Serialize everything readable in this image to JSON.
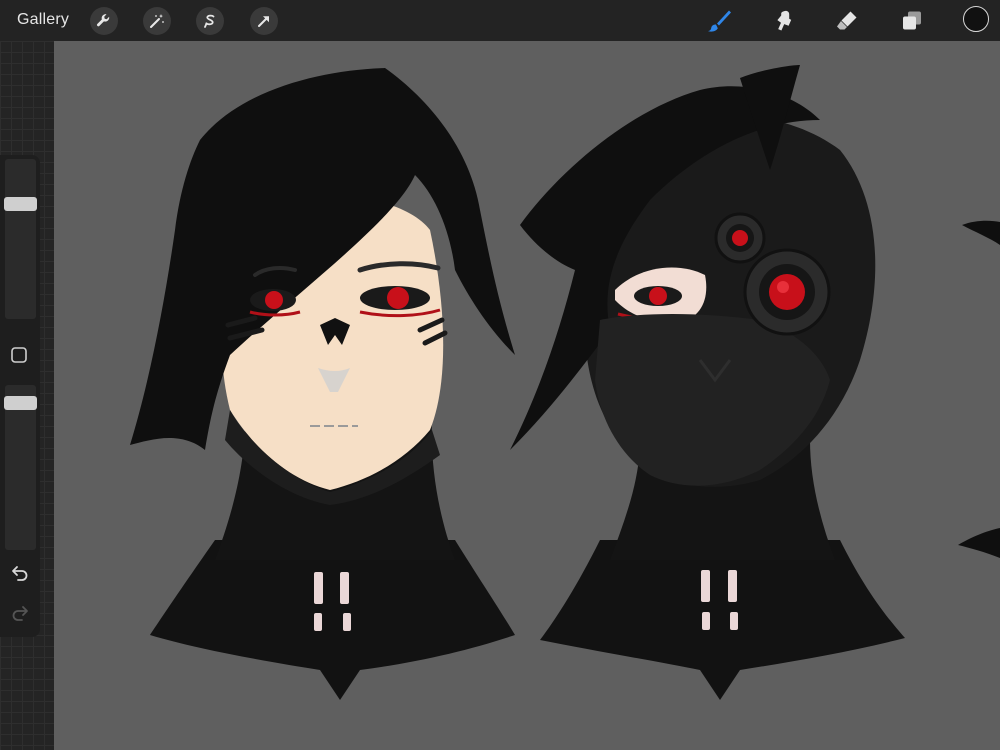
{
  "topbar": {
    "gallery_label": "Gallery"
  },
  "tools": {
    "left": [
      "wrench-icon",
      "magic-wand-icon",
      "selection-icon",
      "transform-arrow-icon"
    ],
    "right": [
      "brush-icon",
      "smudge-icon",
      "eraser-icon",
      "layers-icon"
    ],
    "active_tool": "brush-icon"
  },
  "color": {
    "current": "#111111",
    "accent": "#2f86e8"
  },
  "sidebar": {
    "brush_size_level": 0.74,
    "opacity_level": 0.93,
    "modify_button": "square-icon",
    "undo": "undo-icon",
    "redo": "redo-icon"
  },
  "artwork": {
    "subjects": [
      "human-head",
      "masked-cyborg-head"
    ],
    "eye_color": "#c8101a",
    "skin_color": "#f6dfc6",
    "hair_color": "#0f0f0f"
  }
}
